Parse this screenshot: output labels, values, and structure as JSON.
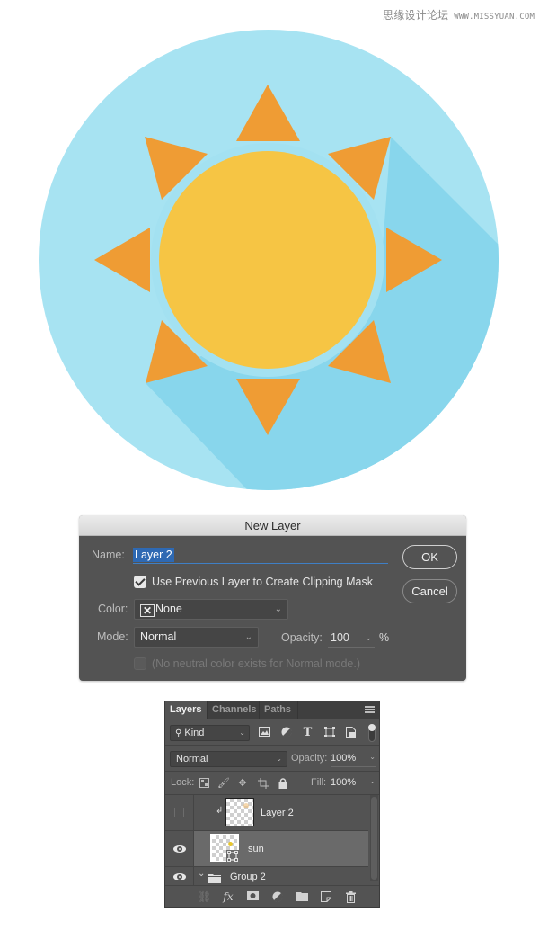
{
  "watermark": {
    "site_name": "思缘设计论坛",
    "url": "WWW.MISSYUAN.COM"
  },
  "illustration": {
    "subject": "flat sun icon with long shadow",
    "colors": {
      "background_circle": "#a7e3f2",
      "long_shadow": "#88d6ec",
      "sun_ring": "#a3e1f1",
      "sun_disc": "#f6c544",
      "rays": "#ef9c34"
    },
    "ray_count": 8
  },
  "dialog": {
    "title": "New Layer",
    "name_label": "Name:",
    "name_value": "Layer 2",
    "clipping_checkbox_label": "Use Previous Layer to Create Clipping Mask",
    "clipping_checked": true,
    "color_label": "Color:",
    "color_value": "None",
    "mode_label": "Mode:",
    "mode_value": "Normal",
    "opacity_label": "Opacity:",
    "opacity_value": "100",
    "opacity_unit": "%",
    "neutral_checkbox_label": "(No neutral color exists for Normal mode.)",
    "neutral_checked": false,
    "neutral_disabled": true,
    "ok_label": "OK",
    "cancel_label": "Cancel",
    "accent_color": "#2e69b3"
  },
  "layers_panel": {
    "tabs": [
      {
        "label": "Layers",
        "active": true
      },
      {
        "label": "Channels",
        "active": false
      },
      {
        "label": "Paths",
        "active": false
      }
    ],
    "filter_kind": "Kind",
    "blend_mode": "Normal",
    "opacity_label": "Opacity:",
    "opacity_value": "100%",
    "lock_label": "Lock:",
    "fill_label": "Fill:",
    "fill_value": "100%",
    "layers": [
      {
        "name": "Layer 2",
        "visible": false,
        "clipped": true,
        "selected": false
      },
      {
        "name": "sun",
        "visible": true,
        "smart_object": true,
        "selected": true
      },
      {
        "name": "Group 2",
        "visible": true,
        "group": true,
        "expanded": false,
        "selected": false
      }
    ],
    "filter_icons": [
      "image-filter-icon",
      "adjustment-filter-icon",
      "type-filter-icon",
      "shape-filter-icon",
      "smart-object-filter-icon"
    ],
    "lock_icons": [
      "lock-transparent-pixels-icon",
      "lock-image-pixels-icon",
      "lock-position-icon",
      "lock-artboard-icon",
      "lock-all-icon"
    ],
    "footer_icons": [
      "link-layers-icon",
      "layer-style-icon",
      "add-mask-icon",
      "new-adjustment-layer-icon",
      "new-group-icon",
      "new-layer-icon",
      "delete-layer-icon"
    ]
  }
}
